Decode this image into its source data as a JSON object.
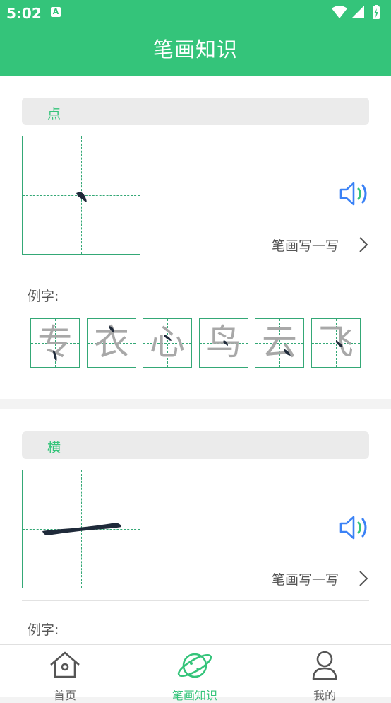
{
  "status_bar": {
    "time": "5:02",
    "notif_letter": "A"
  },
  "header": {
    "title": "笔画知识"
  },
  "strokes": [
    {
      "name": "点",
      "write_label": "笔画写一写",
      "example_label": "例字:",
      "examples": [
        "专",
        "衣",
        "心",
        "鸟",
        "云",
        "飞"
      ]
    },
    {
      "name": "横",
      "write_label": "笔画写一写",
      "example_label": "例字:"
    }
  ],
  "tabbar": {
    "items": [
      {
        "label": "首页",
        "icon": "home-icon",
        "active": false
      },
      {
        "label": "笔画知识",
        "icon": "planet-icon",
        "active": true
      },
      {
        "label": "我的",
        "icon": "person-icon",
        "active": false
      }
    ]
  },
  "colors": {
    "brand": "#34c47a",
    "grid": "#34a876",
    "sound": "#3b82f6"
  }
}
